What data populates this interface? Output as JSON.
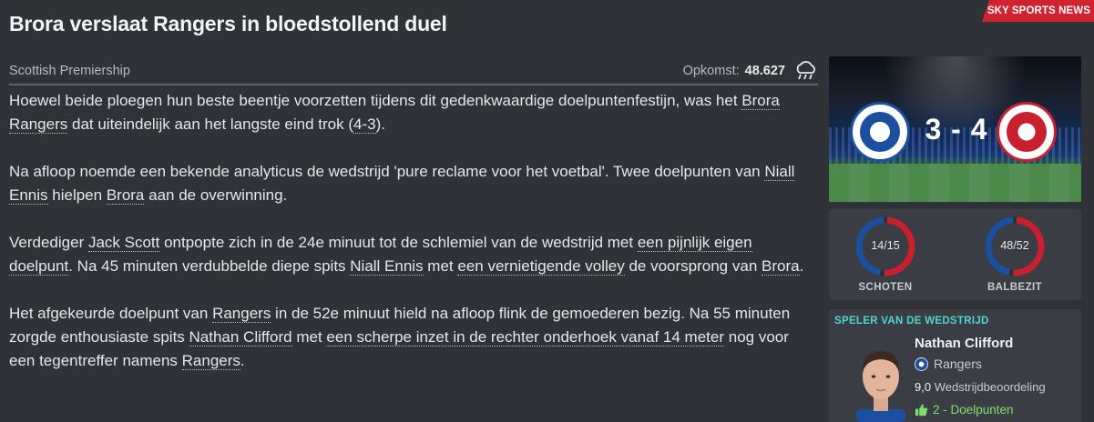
{
  "article": {
    "headline": "Brora verslaat Rangers in bloedstollend duel",
    "source": "SKY SPORTS NEWS",
    "competition": "Scottish Premiership",
    "attendance_label": "Opkomst:",
    "attendance_value": "48.627",
    "weather_icon": "cloud-rain-icon",
    "p1": {
      "t1": "Hoewel beide ploegen hun beste beentje voorzetten tijdens dit gedenkwaardige doelpuntenfestijn, was het ",
      "l1": "Brora Rangers",
      "t2": " dat uiteindelijk aan het langste eind trok (",
      "l2": "4-3",
      "t3": ")."
    },
    "p2": {
      "t1": "Na afloop noemde een bekende analyticus de wedstrijd 'pure reclame voor het voetbal'. Twee doelpunten van ",
      "l1": "Niall Ennis",
      "t2": " hielpen ",
      "l2": "Brora",
      "t3": " aan de overwinning."
    },
    "p3": {
      "t1": "Verdediger ",
      "l1": "Jack Scott",
      "t2": " ontpopte zich in de 24e minuut tot de schlemiel van de wedstrijd met ",
      "l2": "een pijnlijk eigen doelpunt",
      "t3": ". Na 45 minuten verdubbelde diepe spits ",
      "l3": "Niall Ennis",
      "t4": " met ",
      "l4": "een vernietigende volley",
      "t5": " de voorsprong van ",
      "l5": "Brora",
      "t6": "."
    },
    "p4": {
      "t1": "Het afgekeurde doelpunt van ",
      "l1": "Rangers",
      "t2": " in de 52e minuut hield na afloop flink de gemoederen bezig. Na 55 minuten zorgde enthousiaste spits ",
      "l2": "Nathan Clifford",
      "t3": " met ",
      "l3": "een scherpe inzet in de rechter onderhoek vanaf 14 meter",
      "t4": " nog voor een tegentreffer namens ",
      "l4": "Rangers",
      "t5": "."
    }
  },
  "match": {
    "score": "3 - 4",
    "home_color": "#1d4fa0",
    "away_color": "#c8202e"
  },
  "stats": {
    "shots": {
      "value": "14/15",
      "label": "SCHOTEN",
      "home": 14,
      "away": 15
    },
    "possession": {
      "value": "48/52",
      "label": "BALBEZIT",
      "home": 48,
      "away": 52
    }
  },
  "potm": {
    "title": "SPELER VAN DE WEDSTRIJD",
    "name": "Nathan Clifford",
    "club": "Rangers",
    "rating_value": "9,0",
    "rating_label": "Wedstrijdbeoordeling",
    "goals": "2 - Doelpunten",
    "accent": "#52d6c9"
  }
}
